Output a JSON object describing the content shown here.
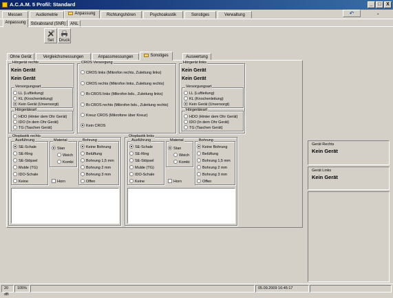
{
  "title": "A.C.A.M. 5 Profil: Standard",
  "window_buttons": {
    "minimize": "_",
    "maximize": "□",
    "close": "X"
  },
  "main_tabs": [
    "Messen",
    "Audiometrie",
    "Anpassung",
    "Richtungshören",
    "Psychoakustik",
    "Sonstiges",
    "Verwaltung"
  ],
  "main_active": "Anpassung",
  "undo_glyph": "↶",
  "corner_dot": ".",
  "sub_tabs": [
    "Anpassung",
    "Störabstand (SNR)",
    "ANL"
  ],
  "toolbar": {
    "set": "Set",
    "druck": "Druck"
  },
  "inner_tabs": [
    "Ohne Gerät",
    "Vergleichsmessungen",
    "Anpassmessungen",
    "Sonstiges",
    "Auswertung"
  ],
  "inner_active": "Sonstiges",
  "left": {
    "title": "Hörgerät rechts",
    "line1": "Kein Gerät",
    "line2": "Kein Gerät",
    "versorgung_title": "Versorgungsart",
    "versorgung": [
      "LL (Luftleitung)",
      "KL (Knochenleitung)",
      "Kein Gerät (Unversorgt)"
    ],
    "geraet_title": "Hörgeräteart",
    "geraet": [
      "HDO (Hinter dem Ohr Gerät)",
      "IDO (In dem Ohr Gerät)",
      "TG (Taschen Gerät)"
    ]
  },
  "cros": {
    "title": "CROS Versorgung",
    "items": [
      "CROS links (Mikrofon rechts, Zuleitung links)",
      "CROS rechts (Mikrofon links, Zuleitung rechts)",
      "Bi-CROS links (Mikrofon bds., Zuleitung links)",
      "Bi-CROS rechts (Mikrofon bds., Zuleitung rechts)",
      "Kreuz CROS (Mikrofone über Kreuz)",
      "Kein CROS"
    ]
  },
  "right": {
    "title": "Hörgerät links",
    "line1": "Kein Gerät",
    "line2": "Kein Gerät",
    "versorgung_title": "Versorgungsart",
    "versorgung": [
      "LL (Luftleitung)",
      "KL (Knochenleitung)",
      "Kein Gerät (Unversorgt)"
    ],
    "geraet_title": "Hörgeräteart",
    "geraet": [
      "HDO (Hinter dem Ohr Gerät)",
      "IDO (In dem Ohr Gerät)",
      "TG (Taschen Gerät)"
    ]
  },
  "oto_r": {
    "title": "Otoplastik rechts",
    "ausfuehrung_title": "Ausführung",
    "ausfuehrung": [
      "SE-Schale",
      "SE-Ring",
      "SE-Stöpsel",
      "Mulde (TG)",
      "IDO-Schale",
      "Keine"
    ],
    "material_title": "Material",
    "material": [
      "Stan",
      "Weich",
      "Kombi"
    ],
    "horn": "Horn",
    "bohrung_title": "Bohrung",
    "bohrung": [
      "Keine Bohrung",
      "Belüftung",
      "Bohrung 1,5 mm",
      "Bohrung 2 mm",
      "Bohrung 3 mm",
      "Offen"
    ]
  },
  "oto_l": {
    "title": "Otoplastik links",
    "ausfuehrung_title": "Ausführung",
    "ausfuehrung": [
      "SE-Schale",
      "SE-Ring",
      "SE-Stöpsel",
      "Mulde (TG)",
      "IDO-Schale",
      "Keine"
    ],
    "material_title": "Material",
    "material": [
      "Stan",
      "Weich",
      "Kombi"
    ],
    "horn": "Horn",
    "bohrung_title": "Bohrung",
    "bohrung": [
      "Keine Bohrung",
      "Belüftung",
      "Bohrung 1,5 mm",
      "Bohrung 2 mm",
      "Bohrung 3 mm",
      "Offen"
    ]
  },
  "side": {
    "rechts_title": "Gerät Rechts",
    "rechts_value": "Kein Gerät",
    "links_title": "Gerät Links",
    "links_value": "Kein Gerät"
  },
  "status": {
    "db": "20 dB",
    "zoom": "105%",
    "datetime": "05.09.2009 16:45:17"
  }
}
